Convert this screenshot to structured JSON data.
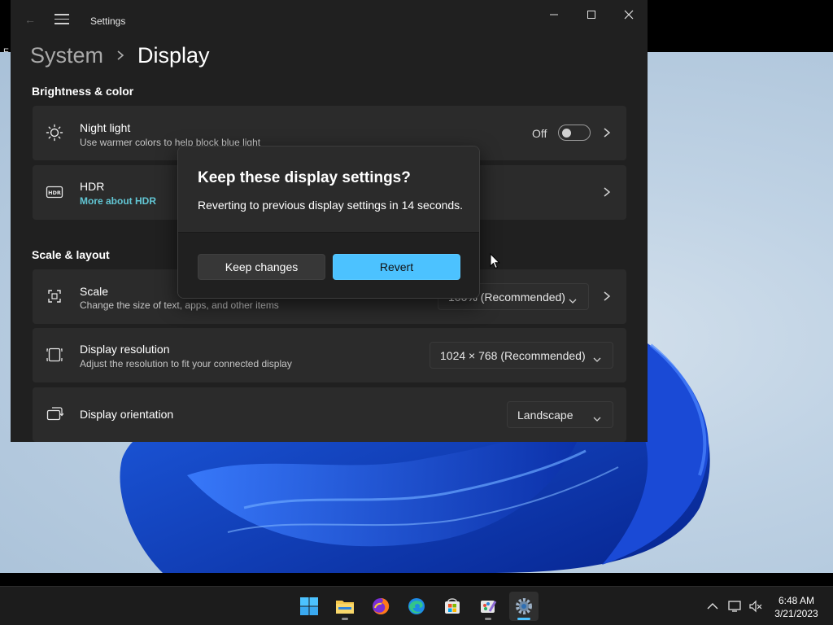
{
  "window": {
    "app_title": "Settings",
    "breadcrumb_parent": "System",
    "breadcrumb_current": "Display"
  },
  "sections": {
    "brightness": "Brightness & color",
    "scale_layout": "Scale & layout"
  },
  "night_light": {
    "title": "Night light",
    "subtitle": "Use warmer colors to help block blue light",
    "toggle_label": "Off",
    "enabled": false
  },
  "hdr": {
    "title": "HDR",
    "link": "More about HDR"
  },
  "scale": {
    "title": "Scale",
    "subtitle": "Change the size of text, apps, and other items",
    "value": "100% (Recommended)"
  },
  "resolution": {
    "title": "Display resolution",
    "subtitle": "Adjust the resolution to fit your connected display",
    "value": "1024 × 768 (Recommended)"
  },
  "orientation": {
    "title": "Display orientation",
    "value": "Landscape"
  },
  "dialog": {
    "title": "Keep these display settings?",
    "message": "Reverting to previous display settings in 14 seconds.",
    "keep_label": "Keep changes",
    "revert_label": "Revert"
  },
  "taskbar": {
    "apps": [
      "start-icon",
      "file-explorer-icon",
      "firefox-icon",
      "edge-icon",
      "store-icon",
      "paint-icon",
      "settings-icon"
    ],
    "time": "6:48 AM",
    "date": "3/21/2023"
  },
  "colors": {
    "accent": "#4cc2ff",
    "link": "#62c6d4",
    "window_bg": "#202020",
    "card_bg": "#2b2b2b"
  }
}
